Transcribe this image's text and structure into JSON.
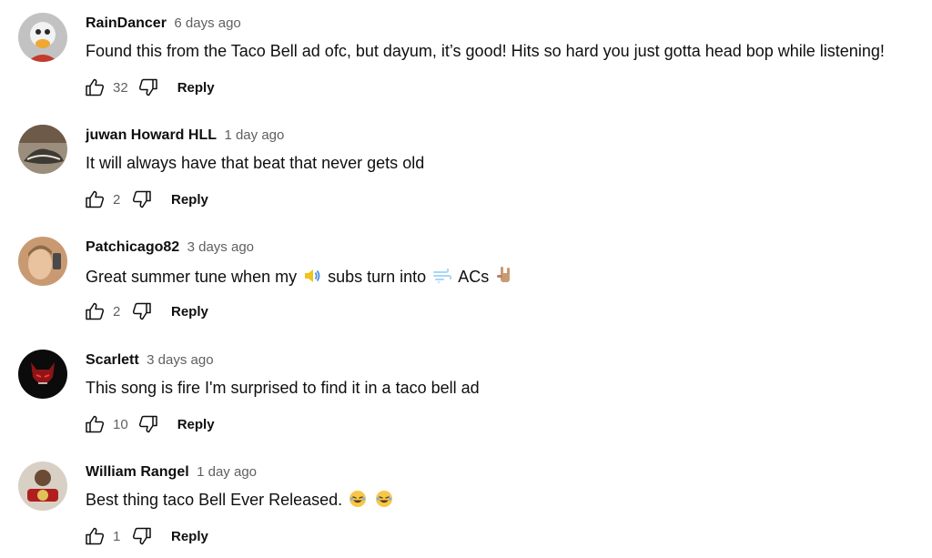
{
  "comments": [
    {
      "author": "RainDancer",
      "time": "6 days ago",
      "text": "Found this from the Taco Bell ad ofc, but dayum, it’s good! Hits so hard you just gotta head bop while listening!",
      "likes": "32",
      "reply_label": "Reply",
      "avatar_color": "#b9b9b9"
    },
    {
      "author": "juwan Howard HLL",
      "time": "1 day ago",
      "text": "It will always have that beat that never gets old",
      "likes": "2",
      "reply_label": "Reply",
      "avatar_color": "#8a7a66"
    },
    {
      "author": "Patchicago82",
      "time": "3 days ago",
      "text_parts": [
        "Great summer tune when my",
        "subs turn into",
        "ACs"
      ],
      "likes": "2",
      "reply_label": "Reply",
      "avatar_color": "#d9a27a"
    },
    {
      "author": "Scarlett",
      "time": "3 days ago",
      "text": "This song is fire I'm surprised to find it in a taco bell ad",
      "likes": "10",
      "reply_label": "Reply",
      "avatar_color": "#0d0d0d"
    },
    {
      "author": "William Rangel",
      "time": "1 day ago",
      "text": "Best thing taco Bell Ever Released.",
      "likes": "1",
      "reply_label": "Reply",
      "avatar_color": "#7a1f1f"
    }
  ],
  "icons": {
    "like": "thumbs-up-icon",
    "dislike": "thumbs-down-icon",
    "speaker": "speaker-emoji-icon",
    "wind": "wind-emoji-icon",
    "horns": "horns-hand-emoji-icon",
    "laugh": "laughing-emoji-icon"
  }
}
